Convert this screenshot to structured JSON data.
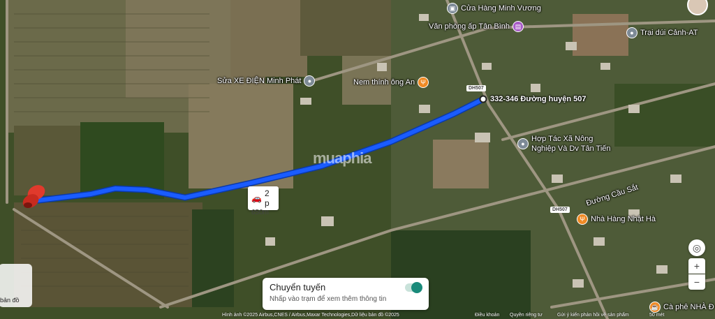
{
  "map": {
    "pois": [
      {
        "label": "Cửa Hàng Minh Vương",
        "kind": "shop",
        "color": "#7d8a96",
        "icon": "bag-icon"
      },
      {
        "label": "Văn phòng ấp Tân Bình",
        "kind": "office",
        "color": "#a85bc6",
        "icon": "building-icon"
      },
      {
        "label": "Trại dúi Cảnh-AT",
        "kind": "place",
        "color": "#7d8a96",
        "icon": "pin-icon"
      },
      {
        "label": "Sửa XE ĐIỆN Minh Phát",
        "kind": "service",
        "color": "#7d8a96",
        "icon": "pin-icon"
      },
      {
        "label": "Nem thính ông An",
        "kind": "food",
        "color": "#f08a24",
        "icon": "fork-icon"
      },
      {
        "label": "Hợp Tác Xã Nông Nghiệp Và Dv Tân Tiến",
        "kind": "coop",
        "color": "#7d8a96",
        "icon": "pin-icon"
      },
      {
        "label": "Nhà Hàng Nhật Hà",
        "kind": "restaurant",
        "color": "#f08a24",
        "icon": "fork-icon"
      },
      {
        "label": "Cà phê NHÀ Đ",
        "kind": "cafe",
        "color": "#f08a24",
        "icon": "cup-icon"
      }
    ],
    "destination_label": "332-346 Đường huyện 507",
    "road_label": "Đường Cầu Sắt",
    "road_shields": [
      "DH507",
      "DH507"
    ],
    "watermark": "muaphia"
  },
  "route": {
    "mode_icon": "car-icon",
    "duration": "2 p",
    "distance": "650m",
    "color": "#1a5cff"
  },
  "transit_card": {
    "title": "Chuyển tuyến",
    "subtitle": "Nhấp vào trạm để xem thêm thông tin",
    "toggle_on": true
  },
  "left_panel": {
    "label": "bản đồ"
  },
  "controls": {
    "zoom_in": "+",
    "zoom_out": "−"
  },
  "attribution": {
    "imagery": "Hình ảnh ©2025 Airbus,CNES / Airbus,Maxar Technologies,Dữ liệu bản đồ ©2025",
    "terms": "Điều khoản",
    "privacy": "Quyền riêng tư",
    "feedback": "Gửi ý kiến phản hồi về sản phẩm",
    "scale": "50 mét"
  }
}
